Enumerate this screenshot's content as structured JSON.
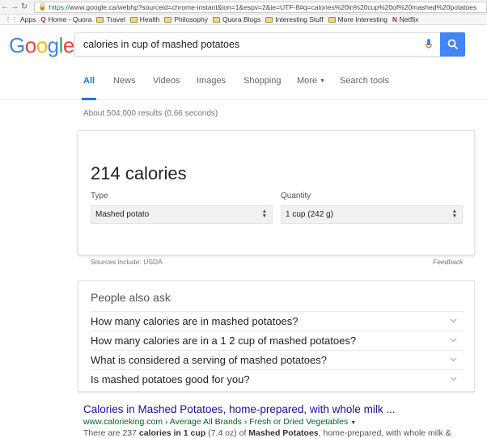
{
  "browser": {
    "url_scheme": "https://",
    "url_rest": "www.google.ca/webhp?sourceid=chrome-instant&ion=1&espv=2&ie=UTF-8#q=calories%20in%20cup%20of%20mashed%20potatoes",
    "bookmarks": [
      {
        "label": "Apps",
        "icon": "apps-grid-icon"
      },
      {
        "label": "Home - Quora",
        "icon": "quora-icon"
      },
      {
        "label": "Travel",
        "icon": "folder-icon"
      },
      {
        "label": "Health",
        "icon": "folder-icon"
      },
      {
        "label": "Philosophy",
        "icon": "folder-icon"
      },
      {
        "label": "Quora Blogs",
        "icon": "folder-icon"
      },
      {
        "label": "Interesting Stuff",
        "icon": "folder-icon"
      },
      {
        "label": "More Interesting",
        "icon": "folder-icon"
      },
      {
        "label": "Netflix",
        "icon": "netflix-icon"
      }
    ]
  },
  "search": {
    "logo_letters": [
      "G",
      "o",
      "o",
      "g",
      "l",
      "e"
    ],
    "query": "calories in cup of mashed potatoes"
  },
  "tabs": [
    "All",
    "News",
    "Videos",
    "Images",
    "Shopping",
    "More",
    "Search tools"
  ],
  "stats": "About 504,000 results (0.66 seconds)",
  "nutrition": {
    "calories": "214 calories",
    "type_label": "Type",
    "type_value": "Mashed potato",
    "quantity_label": "Quantity",
    "quantity_value": "1 cup (242 g)",
    "sources": "Sources include: USDA",
    "feedback": "Feedback"
  },
  "paa": {
    "title": "People also ask",
    "questions": [
      "How many calories are in mashed potatoes?",
      "How many calories are in a 1 2 cup of mashed potatoes?",
      "What is considered a serving of mashed potatoes?",
      "Is mashed potatoes good for you?"
    ]
  },
  "result": {
    "title": "Calories in Mashed Potatoes, home-prepared, with whole milk ...",
    "url": "www.calorieking.com › Average All Brands › Fresh or Dried Vegetables",
    "snippet_pre": "There are 237 ",
    "snippet_b1": "calories in 1 cup",
    "snippet_mid": " (7.4 oz) of ",
    "snippet_b2": "Mashed Potatoes",
    "snippet_post": ", home-prepared, with whole milk &"
  },
  "colors": {
    "accent_blue": "#4285f4",
    "link": "#1a0dab",
    "url_green": "#006621"
  }
}
